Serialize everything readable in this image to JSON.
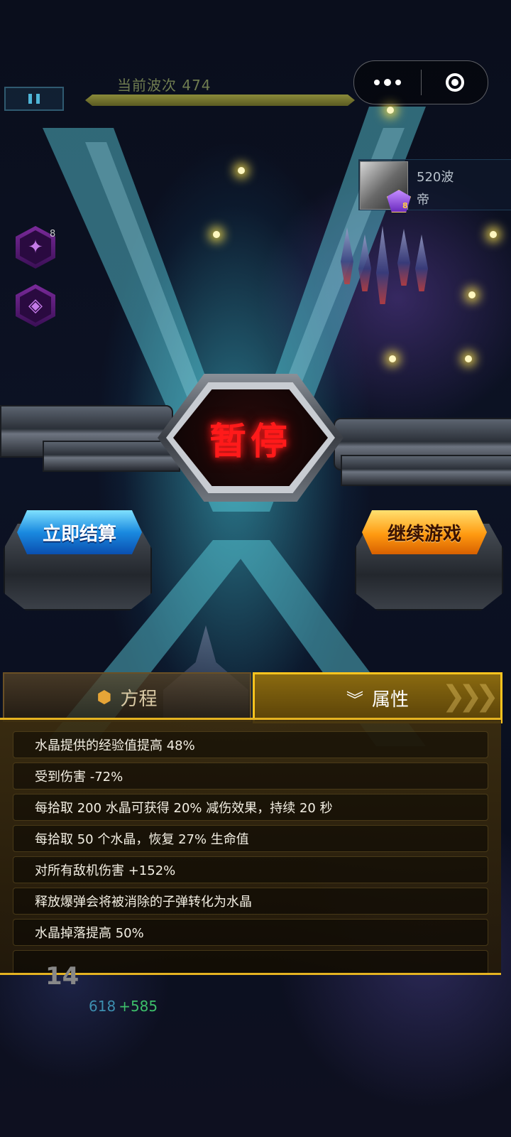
{
  "hud": {
    "wave_label": "当前波次 474",
    "pause_icon": "pause-icon"
  },
  "capsule": {
    "more_icon": "more-dots-icon",
    "close_icon": "target-circle-icon"
  },
  "rival": {
    "wave": "520波",
    "name": "帝",
    "rank_level": "8"
  },
  "skills": {
    "count": "8"
  },
  "pause_screen": {
    "title": "暂停",
    "settle_button": "立即结算",
    "continue_button": "继续游戏"
  },
  "tabs": [
    {
      "label": "方程",
      "icon": "hexagon-icon",
      "active": false
    },
    {
      "label": "属性",
      "icon": "double-chevron-down-icon",
      "active": true
    }
  ],
  "attributes": [
    "水晶提供的经验值提高 48%",
    "受到伤害 -72%",
    "每拾取 200 水晶可获得 20% 减伤效果，持续 20 秒",
    "每拾取 50 个水晶，恢复 27% 生命值",
    "对所有敌机伤害 +152%",
    "释放爆弹会将被消除的子弹转化为水晶",
    "水晶掉落提高 50%"
  ],
  "player_stats": {
    "hp": "14",
    "score": "618",
    "score_gain": "+585"
  },
  "colors": {
    "gold": "#e5b321",
    "pause_red": "#ff1a1a",
    "settle_blue": "#1a8ae0",
    "continue_orange": "#ff9a10"
  }
}
